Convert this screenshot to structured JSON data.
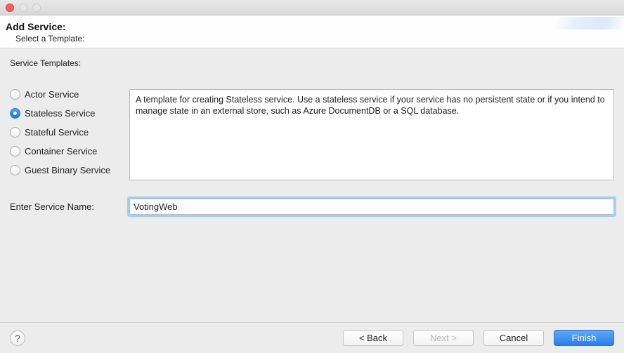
{
  "header": {
    "title": "Add Service:",
    "subtitle": "Select a Template:"
  },
  "section_label": "Service Templates:",
  "templates": {
    "items": [
      {
        "label": "Actor Service"
      },
      {
        "label": "Stateless Service"
      },
      {
        "label": "Stateful Service"
      },
      {
        "label": "Container Service"
      },
      {
        "label": "Guest Binary Service"
      }
    ],
    "selected_index": 1,
    "description": "A template for creating Stateless service.  Use a stateless service if your service has no persistent state or if you intend to manage state in an external store, such as Azure DocumentDB or a SQL database."
  },
  "service_name": {
    "label": "Enter Service Name:",
    "value": "VotingWeb"
  },
  "footer": {
    "help": "?",
    "back": "< Back",
    "next": "Next >",
    "cancel": "Cancel",
    "finish": "Finish"
  }
}
